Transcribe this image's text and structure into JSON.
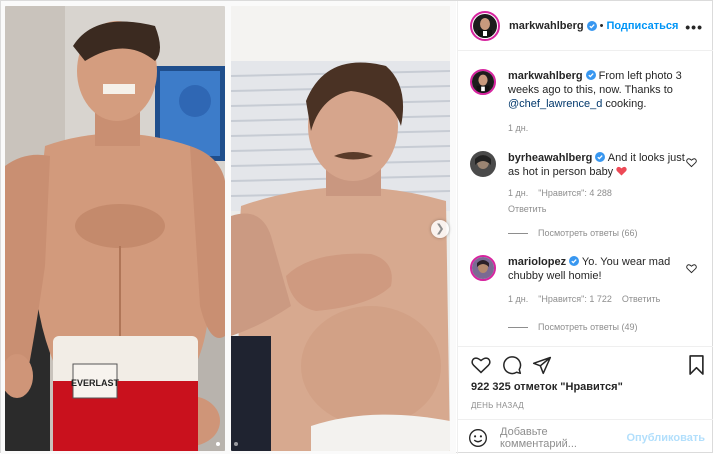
{
  "post": {
    "username": "markwahlberg",
    "follow_label": "Подписаться",
    "separator": "•",
    "more_label": "•••"
  },
  "caption": {
    "username": "markwahlberg",
    "text_before": " From left photo 3 weeks ago to this, now. Thanks to ",
    "mention": "@chef_lawrence_d",
    "text_after": " cooking.",
    "time": "1 дн."
  },
  "comments": [
    {
      "username": "byrheawahlberg",
      "text": " And it looks just as hot in person baby ",
      "emoji": "heart",
      "time": "1 дн.",
      "likes": "\"Нравится\": 4 288",
      "reply": "Ответить",
      "view_replies": "Посмотреть ответы (66)"
    },
    {
      "username": "mariolopez",
      "text": " Yo. You wear mad chubby well homie!",
      "time": "1 дн.",
      "likes": "\"Нравится\": 1 722",
      "reply": "Ответить",
      "view_replies": "Посмотреть ответы (49)"
    }
  ],
  "footer": {
    "likes_count": "922 325 отметок \"Нравится\"",
    "posted": "ДЕНЬ НАЗАД",
    "comment_placeholder": "Добавьте комментарий...",
    "publish_label": "Опубликовать"
  },
  "colors": {
    "link": "#0095f6",
    "verified": "#3897f0",
    "story_ring": "#d6249f",
    "heart": "#ed4956"
  },
  "carousel": {
    "slides": 2,
    "current": 1
  }
}
